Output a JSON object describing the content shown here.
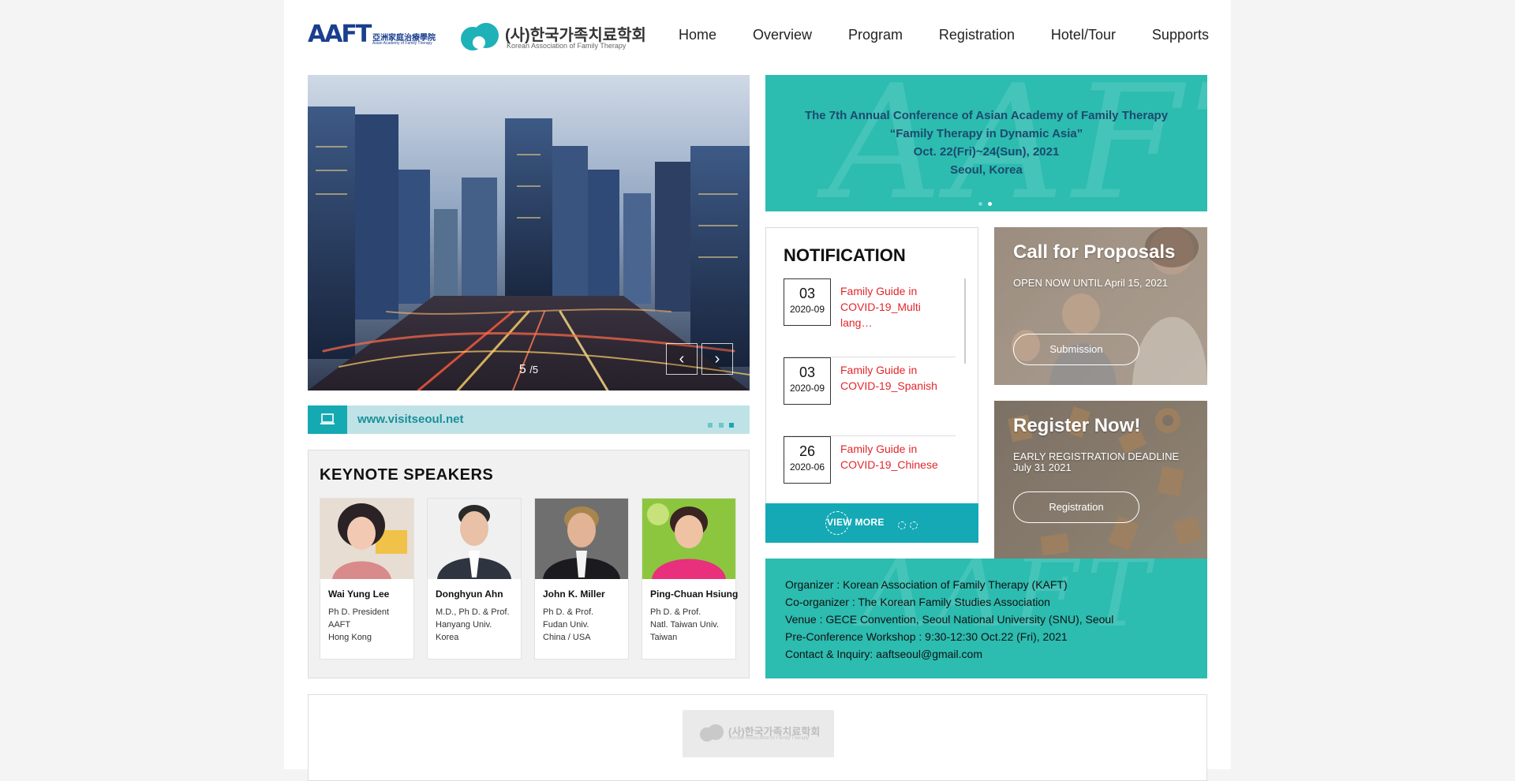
{
  "header": {
    "logo_aaft": {
      "mark": "AAFT",
      "cn": "亞洲家庭治療學院",
      "en": "Asian Academy of Family Therapy"
    },
    "logo_kaft": {
      "ko": "(사)한국가족치료학회",
      "en": "Korean Association of Family Therapy"
    },
    "nav": [
      "Home",
      "Overview",
      "Program",
      "Registration",
      "Hotel/Tour",
      "Supports"
    ]
  },
  "slider": {
    "current": "5",
    "total": "/5",
    "prev_icon": "chevron-left-icon",
    "next_icon": "chevron-right-icon"
  },
  "visit_bar": {
    "icon": "laptop-icon",
    "url": "www.visitseoul.net"
  },
  "keynote": {
    "title": "KEYNOTE SPEAKERS",
    "speakers": [
      {
        "name": "Wai Yung Lee",
        "line1": "Ph D. President",
        "line2": "AAFT",
        "line3": "Hong Kong"
      },
      {
        "name": "Donghyun Ahn",
        "line1": "M.D., Ph D. & Prof.",
        "line2": "Hanyang Univ.",
        "line3": "Korea"
      },
      {
        "name": "John K. Miller",
        "line1": "Ph D. & Prof.",
        "line2": "Fudan Univ.",
        "line3": "China / USA"
      },
      {
        "name": "Ping-Chuan Hsiung",
        "line1": "Ph D. & Prof.",
        "line2": "Natl. Taiwan Univ.",
        "line3": "Taiwan"
      }
    ]
  },
  "banner": {
    "watermark": "AAFT",
    "line1": "The 7th Annual Conference of Asian Academy of Family Therapy",
    "line2": "“Family Therapy in Dynamic Asia”",
    "line3": "Oct. 22(Fri)~24(Sun), 2021",
    "line4": "Seoul, Korea"
  },
  "notification": {
    "title": "NOTIFICATION",
    "items": [
      {
        "day": "03",
        "ym": "2020-09",
        "title": "Family Guide in COVID-19_Multi lang…"
      },
      {
        "day": "03",
        "ym": "2020-09",
        "title": "Family Guide in COVID-19_Spanish"
      },
      {
        "day": "26",
        "ym": "2020-06",
        "title": "Family Guide in COVID-19_Chinese"
      }
    ],
    "view_more": "VIEW MORE"
  },
  "cards": {
    "proposals": {
      "title": "Call for Proposals",
      "sub": "OPEN NOW UNTIL April 15, 2021",
      "button": "Submission"
    },
    "register": {
      "title": "Register Now!",
      "sub1": "EARLY REGISTRATION DEADLINE",
      "sub2": "July 31 2021",
      "button": "Registration"
    }
  },
  "organizer": {
    "watermark": "AAFT",
    "lines": [
      "Organizer : Korean Association of Family Therapy (KAFT)",
      "Co-organizer : The Korean Family Studies Association",
      "Venue : GECE Convention, Seoul National University (SNU), Seoul",
      "Pre-Conference Workshop : 9:30-12:30 Oct.22 (Fri), 2021",
      "Contact & Inquiry: aaftseoul@gmail.com"
    ]
  },
  "footer_logo": {
    "ko": "(사)한국가족치료학회",
    "en": "Korean Association of Family Therapy"
  },
  "colors": {
    "teal": "#2cbcb0",
    "teal_dark": "#14a9b5",
    "navy": "#1b3f8f",
    "notif_red": "#e3262b"
  }
}
